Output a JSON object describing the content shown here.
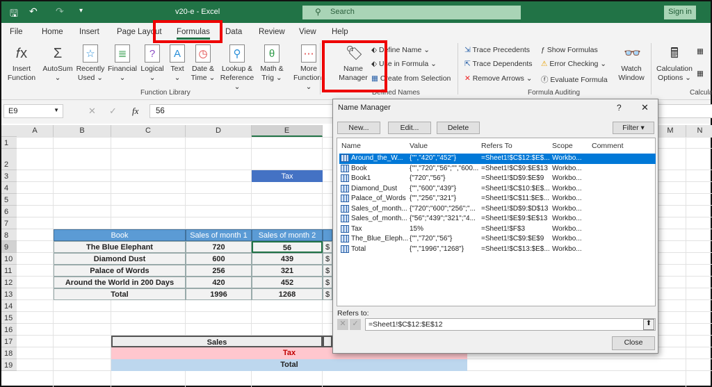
{
  "titlebar": {
    "doc_title": "v20-e  -  Excel",
    "search_placeholder": "Search",
    "signin": "Sign in"
  },
  "tabs": [
    "File",
    "Home",
    "Insert",
    "Page Layout",
    "Formulas",
    "Data",
    "Review",
    "View",
    "Help"
  ],
  "active_tab": "Formulas",
  "ribbon": {
    "function_library": {
      "label": "Function Library",
      "buttons": [
        {
          "l1": "Insert",
          "l2": "Function",
          "icon": "fx-icon"
        },
        {
          "l1": "AutoSum",
          "l2": "⌄",
          "icon": "sigma-icon"
        },
        {
          "l1": "Recently",
          "l2": "Used ⌄",
          "icon": "star-book-icon"
        },
        {
          "l1": "Financial",
          "l2": "⌄",
          "icon": "coins-book-icon"
        },
        {
          "l1": "Logical",
          "l2": "⌄",
          "icon": "question-book-icon"
        },
        {
          "l1": "Text",
          "l2": "⌄",
          "icon": "text-book-icon"
        },
        {
          "l1": "Date &",
          "l2": "Time ⌄",
          "icon": "clock-book-icon"
        },
        {
          "l1": "Lookup &",
          "l2": "Reference ⌄",
          "icon": "magnifier-book-icon"
        },
        {
          "l1": "Math &",
          "l2": "Trig ⌄",
          "icon": "theta-book-icon"
        },
        {
          "l1": "More",
          "l2": "Functions ⌄",
          "icon": "dots-book-icon"
        }
      ]
    },
    "defined_names": {
      "label": "Defined Names",
      "name_manager_l1": "Name",
      "name_manager_l2": "Manager",
      "define_name": "Define Name ⌄",
      "use_in_formula": "Use in Formula ⌄",
      "create_from_selection": "Create from Selection"
    },
    "formula_auditing": {
      "label": "Formula Auditing",
      "trace_precedents": "Trace Precedents",
      "trace_dependents": "Trace Dependents",
      "remove_arrows": "Remove Arrows ⌄",
      "show_formulas": "Show Formulas",
      "error_checking": "Error Checking ⌄",
      "evaluate_formula": "Evaluate Formula",
      "watch_l1": "Watch",
      "watch_l2": "Window"
    },
    "calculation": {
      "label": "Calcula",
      "options_l1": "Calculation",
      "options_l2": "Options ⌄"
    }
  },
  "formula_bar": {
    "name_box": "E9",
    "value": "56"
  },
  "columns": [
    "A",
    "B",
    "C",
    "D",
    "E",
    "M",
    "N"
  ],
  "rows": [
    "1",
    "2",
    "3",
    "4",
    "5",
    "6",
    "7",
    "8",
    "9",
    "10",
    "11",
    "12",
    "13",
    "14",
    "15",
    "16",
    "17",
    "18",
    "19"
  ],
  "sheet": {
    "tax_label": "Tax",
    "headers": [
      "Book",
      "Sales of month 1",
      "Sales of month 2"
    ],
    "data": [
      [
        "The Blue Elephant",
        "720",
        "56"
      ],
      [
        "Diamond Dust",
        "600",
        "439"
      ],
      [
        "Palace of Words",
        "256",
        "321"
      ],
      [
        "Around the World in 200 Days",
        "420",
        "452"
      ],
      [
        "Total",
        "1996",
        "1268"
      ]
    ],
    "f_peek": "$",
    "sales": "Sales",
    "tax": "Tax",
    "total": "Total"
  },
  "dialog": {
    "title": "Name Manager",
    "help": "?",
    "close_x": "✕",
    "new": "New...",
    "edit": "Edit...",
    "delete": "Delete",
    "filter": "Filter ▾",
    "columns": [
      "Name",
      "Value",
      "Refers To",
      "Scope",
      "Comment"
    ],
    "rows": [
      [
        "Around_the_W...",
        "{\"\",\"420\",\"452\"}",
        "=Sheet1!$C$12:$E$...",
        "Workbo..."
      ],
      [
        "Book",
        "{\"\",\"720\",\"56\";\"\",\"600...",
        "=Sheet1!$C$9:$E$13",
        "Workbo..."
      ],
      [
        "Book1",
        "{\"720\",\"56\"}",
        "=Sheet1!$D$9:$E$9",
        "Workbo..."
      ],
      [
        "Diamond_Dust",
        "{\"\",\"600\",\"439\"}",
        "=Sheet1!$C$10:$E$...",
        "Workbo..."
      ],
      [
        "Palace_of_Words",
        "{\"\",\"256\",\"321\"}",
        "=Sheet1!$C$11:$E$...",
        "Workbo..."
      ],
      [
        "Sales_of_month...",
        "{\"720\";\"600\";\"256\";\"...",
        "=Sheet1!$D$9:$D$13",
        "Workbo..."
      ],
      [
        "Sales_of_month...",
        "{\"56\";\"439\";\"321\";\"4...",
        "=Sheet1!$E$9:$E$13",
        "Workbo..."
      ],
      [
        "Tax",
        "15%",
        "=Sheet1!$F$3",
        "Workbo..."
      ],
      [
        "The_Blue_Eleph...",
        "{\"\",\"720\",\"56\"}",
        "=Sheet1!$C$9:$E$9",
        "Workbo..."
      ],
      [
        "Total",
        "{\"\",\"1996\",\"1268\"}",
        "=Sheet1!$C$13:$E$...",
        "Workbo..."
      ]
    ],
    "selected_row": 0,
    "refers_to_label": "Refers to:",
    "refers_to_value": "=Sheet1!$C$12:$E$12",
    "close": "Close"
  },
  "colors": {
    "excel_green": "#217346",
    "header_blue": "#5b9bd5",
    "tax_blue": "#4472c4",
    "pink": "#ffc7ce",
    "light_blue": "#bdd7ee",
    "highlight": "#ff0000",
    "selection": "#0078d7"
  }
}
